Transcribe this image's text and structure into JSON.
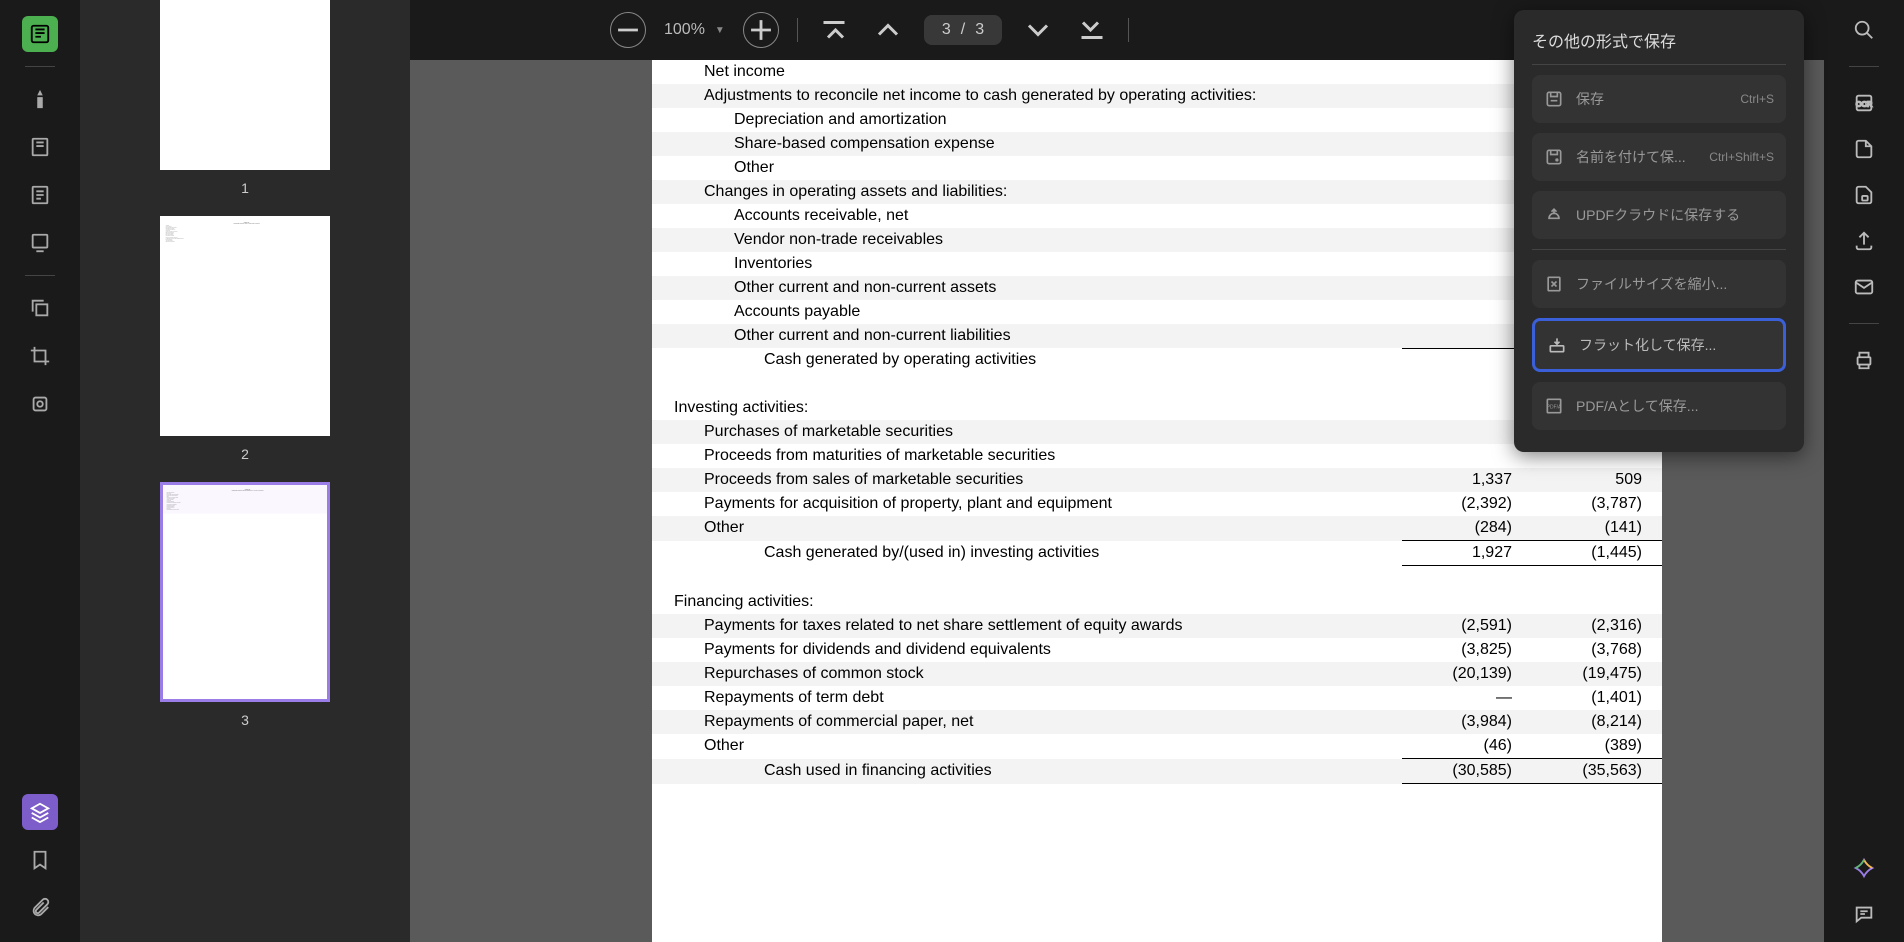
{
  "toolbar": {
    "zoom": "100%",
    "current_page": "3",
    "page_sep": "/",
    "total_pages": "3"
  },
  "thumbnails": {
    "labels": [
      "1",
      "2",
      "3"
    ],
    "selected_index": 2
  },
  "save_panel": {
    "title": "その他の形式で保存",
    "items": [
      {
        "label": "保存",
        "shortcut": "Ctrl+S"
      },
      {
        "label": "名前を付けて保...",
        "shortcut": "Ctrl+Shift+S"
      },
      {
        "label": "UPDFクラウドに保存する",
        "shortcut": ""
      }
    ],
    "items2": [
      {
        "label": "ファイルサイズを縮小...",
        "shortcut": ""
      },
      {
        "label": "フラット化して保存...",
        "shortcut": "",
        "highlight": true
      },
      {
        "label": "PDF/Aとして保存...",
        "shortcut": ""
      }
    ]
  },
  "document": {
    "rows": [
      {
        "label": "Net income",
        "indent": 1,
        "v1": "",
        "v2": "",
        "stripe": false
      },
      {
        "label": "Adjustments to reconcile net income to cash generated by operating activities:",
        "indent": 1,
        "v1": "",
        "v2": "",
        "stripe": true
      },
      {
        "label": "Depreciation and amortization",
        "indent": 2,
        "v1": "",
        "v2": "",
        "stripe": false
      },
      {
        "label": "Share-based compensation expense",
        "indent": 2,
        "v1": "",
        "v2": "",
        "stripe": true
      },
      {
        "label": "Other",
        "indent": 2,
        "v1": "",
        "v2": "",
        "stripe": false
      },
      {
        "label": "Changes in operating assets and liabilities:",
        "indent": 1,
        "v1": "",
        "v2": "",
        "stripe": true
      },
      {
        "label": "Accounts receivable, net",
        "indent": 2,
        "v1": "",
        "v2": "",
        "stripe": false
      },
      {
        "label": "Vendor non-trade receivables",
        "indent": 2,
        "v1": "",
        "v2": "",
        "stripe": true
      },
      {
        "label": "Inventories",
        "indent": 2,
        "v1": "",
        "v2": "",
        "stripe": false
      },
      {
        "label": "Other current and non-current assets",
        "indent": 2,
        "v1": "",
        "v2": "",
        "stripe": true
      },
      {
        "label": "Accounts payable",
        "indent": 2,
        "v1": "",
        "v2": "",
        "stripe": false
      },
      {
        "label": "Other current and non-current liabilities",
        "indent": 2,
        "v1": "",
        "v2": "",
        "stripe": true
      },
      {
        "label": "Cash generated by operating activities",
        "indent": 3,
        "v1": "",
        "v2": "",
        "stripe": false,
        "topline": true
      },
      {
        "label": "",
        "indent": 0,
        "v1": "",
        "v2": "",
        "empty": true
      },
      {
        "label": "Investing activities:",
        "indent": 0,
        "v1": "",
        "v2": "",
        "stripe": false
      },
      {
        "label": "Purchases of marketable securities",
        "indent": 1,
        "v1": "",
        "v2": "",
        "stripe": true
      },
      {
        "label": "Proceeds from maturities of marketable securities",
        "indent": 1,
        "v1": "",
        "v2": "",
        "stripe": false
      },
      {
        "label": "Proceeds from sales of marketable securities",
        "indent": 1,
        "v1": "1,337",
        "v2": "509",
        "stripe": true
      },
      {
        "label": "Payments for acquisition of property, plant and equipment",
        "indent": 1,
        "v1": "(2,392)",
        "v2": "(3,787)",
        "stripe": false
      },
      {
        "label": "Other",
        "indent": 1,
        "v1": "(284)",
        "v2": "(141)",
        "stripe": true
      },
      {
        "label": "Cash generated by/(used in) investing activities",
        "indent": 3,
        "v1": "1,927",
        "v2": "(1,445)",
        "stripe": false,
        "topline": true,
        "bottomline": true
      },
      {
        "label": "",
        "indent": 0,
        "v1": "",
        "v2": "",
        "empty": true
      },
      {
        "label": "Financing activities:",
        "indent": 0,
        "v1": "",
        "v2": "",
        "stripe": false
      },
      {
        "label": "Payments for taxes related to net share settlement of equity awards",
        "indent": 1,
        "v1": "(2,591)",
        "v2": "(2,316)",
        "stripe": true
      },
      {
        "label": "Payments for dividends and dividend equivalents",
        "indent": 1,
        "v1": "(3,825)",
        "v2": "(3,768)",
        "stripe": false
      },
      {
        "label": "Repurchases of common stock",
        "indent": 1,
        "v1": "(20,139)",
        "v2": "(19,475)",
        "stripe": true
      },
      {
        "label": "Repayments of term debt",
        "indent": 1,
        "v1": "—",
        "v2": "(1,401)",
        "stripe": false
      },
      {
        "label": "Repayments of commercial paper, net",
        "indent": 1,
        "v1": "(3,984)",
        "v2": "(8,214)",
        "stripe": true
      },
      {
        "label": "Other",
        "indent": 1,
        "v1": "(46)",
        "v2": "(389)",
        "stripe": false
      },
      {
        "label": "Cash used in financing activities",
        "indent": 3,
        "v1": "(30,585)",
        "v2": "(35,563)",
        "stripe": true,
        "topline": true,
        "bottomline": true
      },
      {
        "label": "",
        "indent": 0,
        "v1": "",
        "v2": "",
        "stripe": false,
        "empty": true
      }
    ]
  }
}
